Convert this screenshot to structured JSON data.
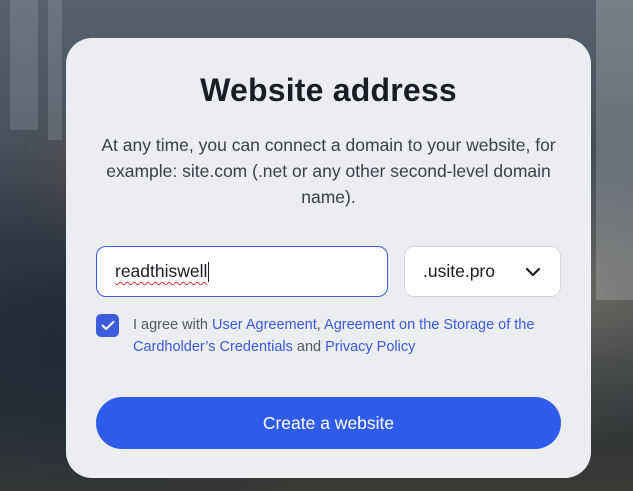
{
  "dialog": {
    "title": "Website address",
    "description": "At any time, you can connect a domain to your website, for example: site.com (.net or any other second-level domain name)."
  },
  "form": {
    "domain_value": "readthiswell",
    "tld_selected": ".usite.pro",
    "agree_checked": true,
    "agree_prefix": "I agree with ",
    "link_user_agreement": "User Agreement",
    "sep_comma": ", ",
    "link_storage_agreement": "Agreement on the Storage of the Cardholder’s Credentials",
    "sep_and": " and ",
    "link_privacy_policy": "Privacy Policy",
    "submit_label": "Create a website"
  },
  "colors": {
    "accent": "#2f5bea",
    "card_bg": "#ebedf0",
    "title_text": "#1a1d24"
  },
  "icons": {
    "dropdown": "chevron-down-icon",
    "checkbox": "checkmark-icon"
  }
}
